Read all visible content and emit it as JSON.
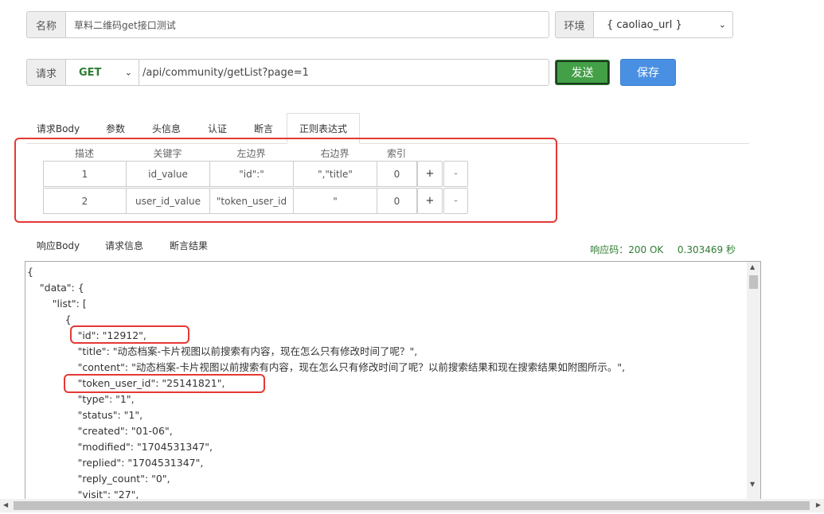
{
  "form": {
    "name_label": "名称",
    "name_value": "草料二维码get接口测试",
    "env_label": "环境",
    "env_value": "{ caoliao_url }",
    "request_label": "请求",
    "method": "GET",
    "url": "/api/community/getList?page=1",
    "send_label": "发送",
    "save_label": "保存"
  },
  "tabs": [
    "请求Body",
    "参数",
    "头信息",
    "认证",
    "断言",
    "正则表达式"
  ],
  "regex_table": {
    "headers": [
      "描述",
      "关键字",
      "左边界",
      "右边界",
      "索引"
    ],
    "rows": [
      {
        "desc": "1",
        "key": "id_value",
        "left": "\"id\":\"",
        "right": "\",\"title\"",
        "index": "0"
      },
      {
        "desc": "2",
        "key": "user_id_value",
        "left": "\"token_user_id",
        "right": "\"",
        "index": "0"
      }
    ],
    "add_label": "+",
    "remove_label": "-"
  },
  "response_tabs": [
    "响应Body",
    "请求信息",
    "断言结果"
  ],
  "status": {
    "code_label": "响应码：200 OK",
    "time_label": "0.303469 秒",
    "color": "#2e7d32"
  },
  "response_lines": [
    "{",
    "    \"data\": {",
    "        \"list\": [",
    "            {",
    "                \"id\": \"12912\",",
    "                \"title\": \"动态档案-卡片视图以前搜索有内容，现在怎么只有修改时间了呢？\",",
    "                \"content\": \"动态档案-卡片视图以前搜索有内容，现在怎么只有修改时间了呢？以前搜索结果和现在搜索结果如附图所示。\",",
    "                \"token_user_id\": \"25141821\",",
    "                \"type\": \"1\",",
    "                \"status\": \"1\",",
    "                \"created\": \"01-06\",",
    "                \"modified\": \"1704531347\",",
    "                \"replied\": \"1704531347\",",
    "                \"reply_count\": \"0\",",
    "                \"visit\": \"27\","
  ]
}
